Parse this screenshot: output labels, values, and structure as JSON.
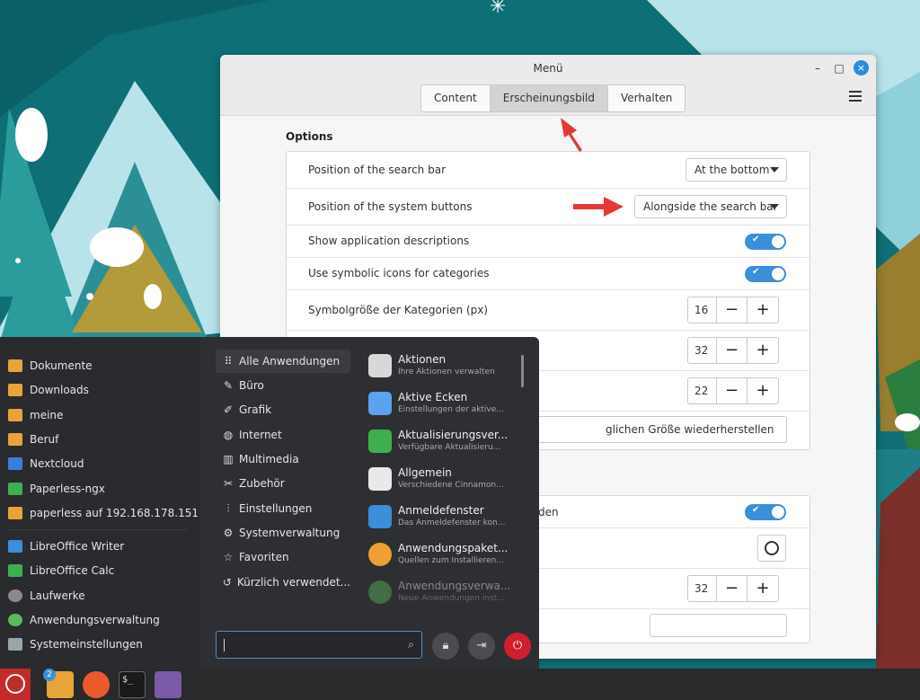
{
  "window": {
    "title": "Menü",
    "tabs": [
      "Content",
      "Erscheinungsbild",
      "Verhalten"
    ],
    "active_tab": "Erscheinungsbild",
    "controls": {
      "minimize": "–",
      "maximize": "□",
      "close": "×"
    }
  },
  "options": {
    "heading": "Options",
    "search_bar_label": "Position of the search bar",
    "search_bar_value": "At the bottom",
    "system_buttons_label": "Position of the system buttons",
    "system_buttons_value": "Alongside the search bar",
    "show_descriptions_label": "Show application descriptions",
    "show_descriptions_on": true,
    "symbolic_icons_label": "Use symbolic icons for categories",
    "symbolic_icons_on": true,
    "category_icon_size_label": "Symbolgröße der Kategorien (px)",
    "category_icon_size": "16",
    "spin2_value": "32",
    "spin3_value": "22",
    "reset_size_text": "glichen Größe wiederherstellen"
  },
  "lower": {
    "toggle_label_fragment": "den",
    "toggle_on": true,
    "spin_value": "32"
  },
  "menu": {
    "places": [
      {
        "label": "Dokumente",
        "color": "#e8a33a"
      },
      {
        "label": "Downloads",
        "color": "#e8a33a"
      },
      {
        "label": "meine",
        "color": "#e8a33a"
      },
      {
        "label": "Beruf",
        "color": "#e8a33a"
      },
      {
        "label": "Nextcloud",
        "color": "#3d7dd9"
      },
      {
        "label": "Paperless-ngx",
        "color": "#3fae4f"
      },
      {
        "label": "paperless auf 192.168.178.151",
        "color": "#e8a33a"
      }
    ],
    "favorites": [
      {
        "label": "LibreOffice Writer",
        "color": "#3a8fd8"
      },
      {
        "label": "LibreOffice Calc",
        "color": "#3fae4f"
      },
      {
        "label": "Laufwerke",
        "color": "#8a8a8a"
      },
      {
        "label": "Anwendungsverwaltung",
        "color": "#5cb85c"
      },
      {
        "label": "Systemeinstellungen",
        "color": "#9aa5ab"
      }
    ],
    "categories": [
      {
        "icon": "⠿",
        "label": "Alle Anwendungen"
      },
      {
        "icon": "✎",
        "label": "Büro"
      },
      {
        "icon": "✐",
        "label": "Grafik"
      },
      {
        "icon": "◍",
        "label": "Internet"
      },
      {
        "icon": "▥",
        "label": "Multimedia"
      },
      {
        "icon": "✂",
        "label": "Zubehör"
      },
      {
        "icon": "⫶",
        "label": "Einstellungen"
      },
      {
        "icon": "⚙",
        "label": "Systemverwaltung"
      },
      {
        "icon": "☆",
        "label": "Favoriten"
      },
      {
        "icon": "↺",
        "label": "Kürzlich verwendet..."
      }
    ],
    "apps": [
      {
        "name": "Aktionen",
        "desc": "Ihre Aktionen verwalten",
        "color": "#d8d8d8"
      },
      {
        "name": "Aktive Ecken",
        "desc": "Einstellungen der aktive...",
        "color": "#5aa3ee"
      },
      {
        "name": "Aktualisierungsver...",
        "desc": "Verfügbare Aktualisieru...",
        "color": "#3fae4f"
      },
      {
        "name": "Allgemein",
        "desc": "Verschiedene Cinnamon...",
        "color": "#e9e9e9"
      },
      {
        "name": "Anmeldefenster",
        "desc": "Das Anmeldefenster kon...",
        "color": "#3a8fd8"
      },
      {
        "name": "Anwendungspaket...",
        "desc": "Quellen zum Installieren...",
        "color": "#f0a030"
      },
      {
        "name": "Anwendungsverwa...",
        "desc": "Neue Anwendungen inst...",
        "color": "#5cb85c"
      }
    ],
    "search_placeholder": ""
  },
  "taskbar": {
    "badge_count": "2"
  },
  "colors": {
    "accent": "#3a8fd8",
    "annotation_arrow": "#e53935",
    "power": "#d01f2c"
  }
}
